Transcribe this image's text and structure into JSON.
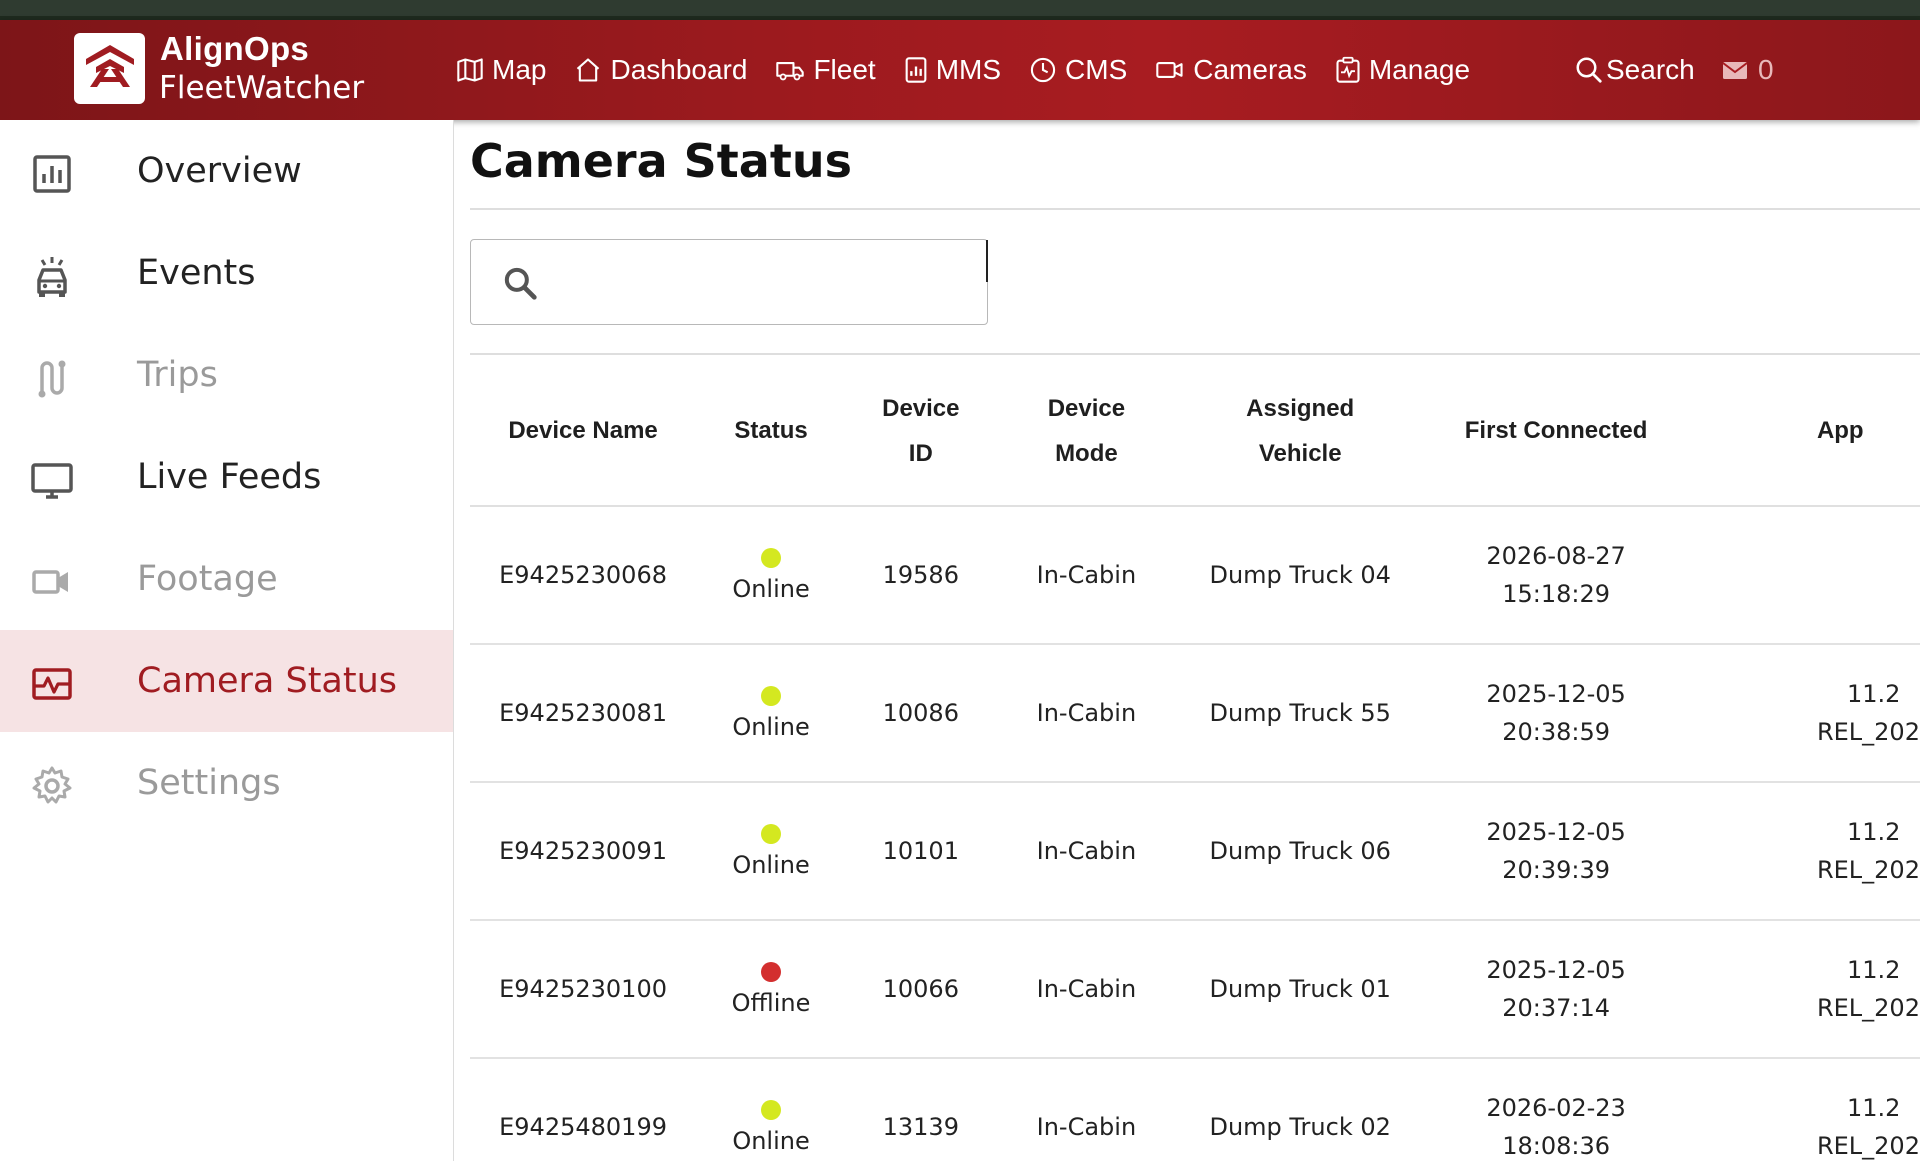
{
  "brand": {
    "name": "AlignOps",
    "product": "FleetWatcher"
  },
  "nav": {
    "items": [
      {
        "label": "Map",
        "icon": "map-icon"
      },
      {
        "label": "Dashboard",
        "icon": "home-icon"
      },
      {
        "label": "Fleet",
        "icon": "truck-icon"
      },
      {
        "label": "MMS",
        "icon": "bar-chart-icon"
      },
      {
        "label": "CMS",
        "icon": "clock-icon"
      },
      {
        "label": "Cameras",
        "icon": "camera-icon"
      },
      {
        "label": "Manage",
        "icon": "clipboard-icon"
      }
    ],
    "search_label": "Search",
    "mail_count": "0"
  },
  "sidebar": {
    "items": [
      {
        "label": "Overview",
        "icon": "chart-icon",
        "state": "enabled"
      },
      {
        "label": "Events",
        "icon": "alarm-car-icon",
        "state": "enabled"
      },
      {
        "label": "Trips",
        "icon": "route-icon",
        "state": "disabled"
      },
      {
        "label": "Live Feeds",
        "icon": "monitor-icon",
        "state": "enabled"
      },
      {
        "label": "Footage",
        "icon": "video-icon",
        "state": "disabled"
      },
      {
        "label": "Camera Status",
        "icon": "pulse-icon",
        "state": "active"
      },
      {
        "label": "Settings",
        "icon": "gear-icon",
        "state": "disabled"
      }
    ]
  },
  "main": {
    "title": "Camera Status",
    "search": {
      "value": "",
      "placeholder": ""
    },
    "table": {
      "headers": {
        "name": "Device Name",
        "status": "Status",
        "id_1": "Device",
        "id_2": "ID",
        "mode_1": "Device",
        "mode_2": "Mode",
        "veh_1": "Assigned",
        "veh_2": "Vehicle",
        "first": "First Connected",
        "app": "App"
      },
      "rows": [
        {
          "name": "E9425230068",
          "status": "Online",
          "id": "19586",
          "mode": "In-Cabin",
          "vehicle": "Dump Truck 04",
          "date": "2026-08-27",
          "time": "15:18:29",
          "app_1": "",
          "app_2": ""
        },
        {
          "name": "E9425230081",
          "status": "Online",
          "id": "10086",
          "mode": "In-Cabin",
          "vehicle": "Dump Truck 55",
          "date": "2025-12-05",
          "time": "20:38:59",
          "app_1": "11.2",
          "app_2": "REL_202"
        },
        {
          "name": "E9425230091",
          "status": "Online",
          "id": "10101",
          "mode": "In-Cabin",
          "vehicle": "Dump Truck 06",
          "date": "2025-12-05",
          "time": "20:39:39",
          "app_1": "11.2",
          "app_2": "REL_202"
        },
        {
          "name": "E9425230100",
          "status": "Offline",
          "id": "10066",
          "mode": "In-Cabin",
          "vehicle": "Dump Truck 01",
          "date": "2025-12-05",
          "time": "20:37:14",
          "app_1": "11.2",
          "app_2": "REL_202"
        },
        {
          "name": "E9425480199",
          "status": "Online",
          "id": "13139",
          "mode": "In-Cabin",
          "vehicle": "Dump Truck 02",
          "date": "2026-02-23",
          "time": "18:08:36",
          "app_1": "11.2",
          "app_2": "REL_202"
        }
      ]
    }
  },
  "colors": {
    "header": "#9c1a1e",
    "accent": "#a01c21",
    "active_bg": "#f6e3e4",
    "online": "#d4e820",
    "offline": "#d32f2f"
  }
}
